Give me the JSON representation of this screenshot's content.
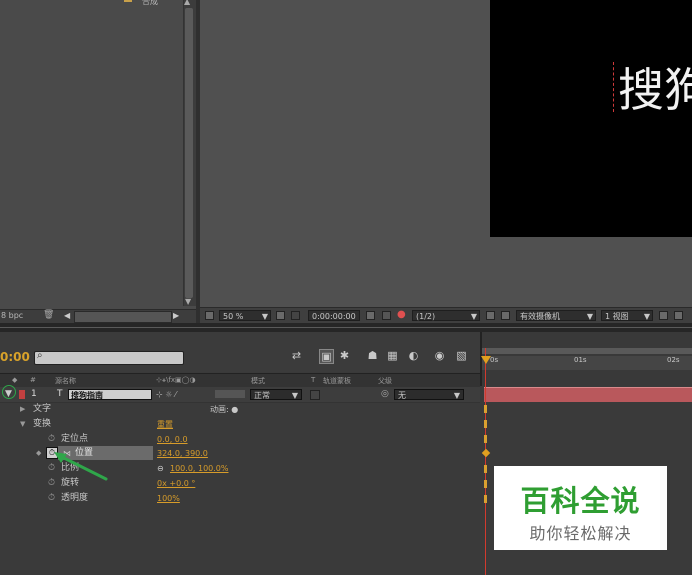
{
  "project_panel": {
    "top_item_text": "合成",
    "bit_depth": "8 bpc"
  },
  "viewer": {
    "comp_text": "搜狗",
    "zoom": "50 %",
    "timecode": "0:00:00:00",
    "resolution": "(1/2)",
    "camera": "有效摄像机",
    "views": "1 视图"
  },
  "timeline": {
    "timecode": "0:00",
    "search_placeholder": "",
    "columns": {
      "num": "#",
      "source_name": "源名称",
      "switches": "⊹⚹\\fx▣◯◑",
      "mode": "模式",
      "trkmat": "T",
      "trkmat_label": "轨道蒙板",
      "parent": "父级"
    },
    "layer": {
      "index": "1",
      "type_glyph": "T",
      "name": "搜狗指南",
      "mode": "正常",
      "parent": "无"
    },
    "rows": {
      "text": {
        "label": "文字",
        "extra": "动画: ●"
      },
      "transform": {
        "label": "变换",
        "reset": "重置"
      },
      "anchor": {
        "label": "定位点",
        "value": "0.0, 0.0"
      },
      "position": {
        "label": "位置",
        "value": "324.0, 390.0"
      },
      "scale": {
        "label": "比例",
        "value": "100.0, 100.0%"
      },
      "rotation": {
        "label": "旋转",
        "value": "0x +0.0 °"
      },
      "opacity": {
        "label": "透明度",
        "value": "100%"
      }
    },
    "ruler": [
      "0s",
      "01s",
      "02s"
    ]
  },
  "watermark": {
    "title": "百科全说",
    "subtitle": "助你轻松解决"
  },
  "colors": {
    "accent_orange": "#d79c2a",
    "layer_bar": "#b9585c",
    "playhead": "#d13a2e",
    "watermark_green": "#2f9e32"
  }
}
